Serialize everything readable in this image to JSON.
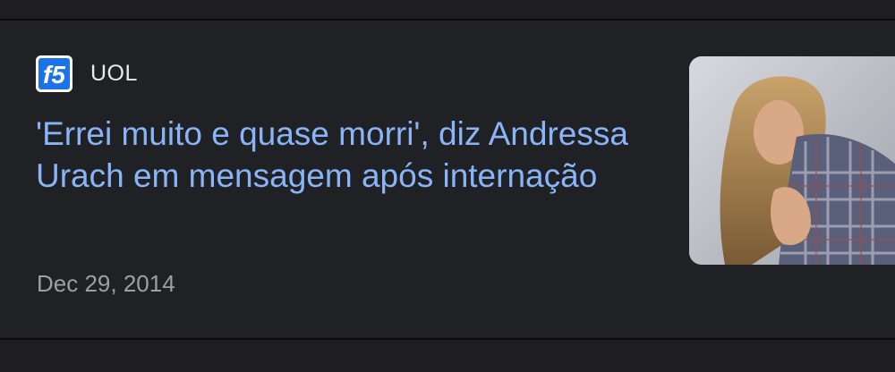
{
  "article": {
    "source": {
      "name": "UOL",
      "logo_icon": "f5-logo-icon",
      "logo_text": "f5"
    },
    "headline": "'Errei muito e quase morri', diz Andressa Urach em mensagem após internação",
    "date": "Dec 29, 2014",
    "thumbnail_icon": "article-thumbnail-image"
  },
  "colors": {
    "background": "#202124",
    "headline": "#8ab4f8",
    "source_text": "#e8eaed",
    "date_text": "#9aa0a6",
    "logo_blue": "#1a73e8"
  }
}
